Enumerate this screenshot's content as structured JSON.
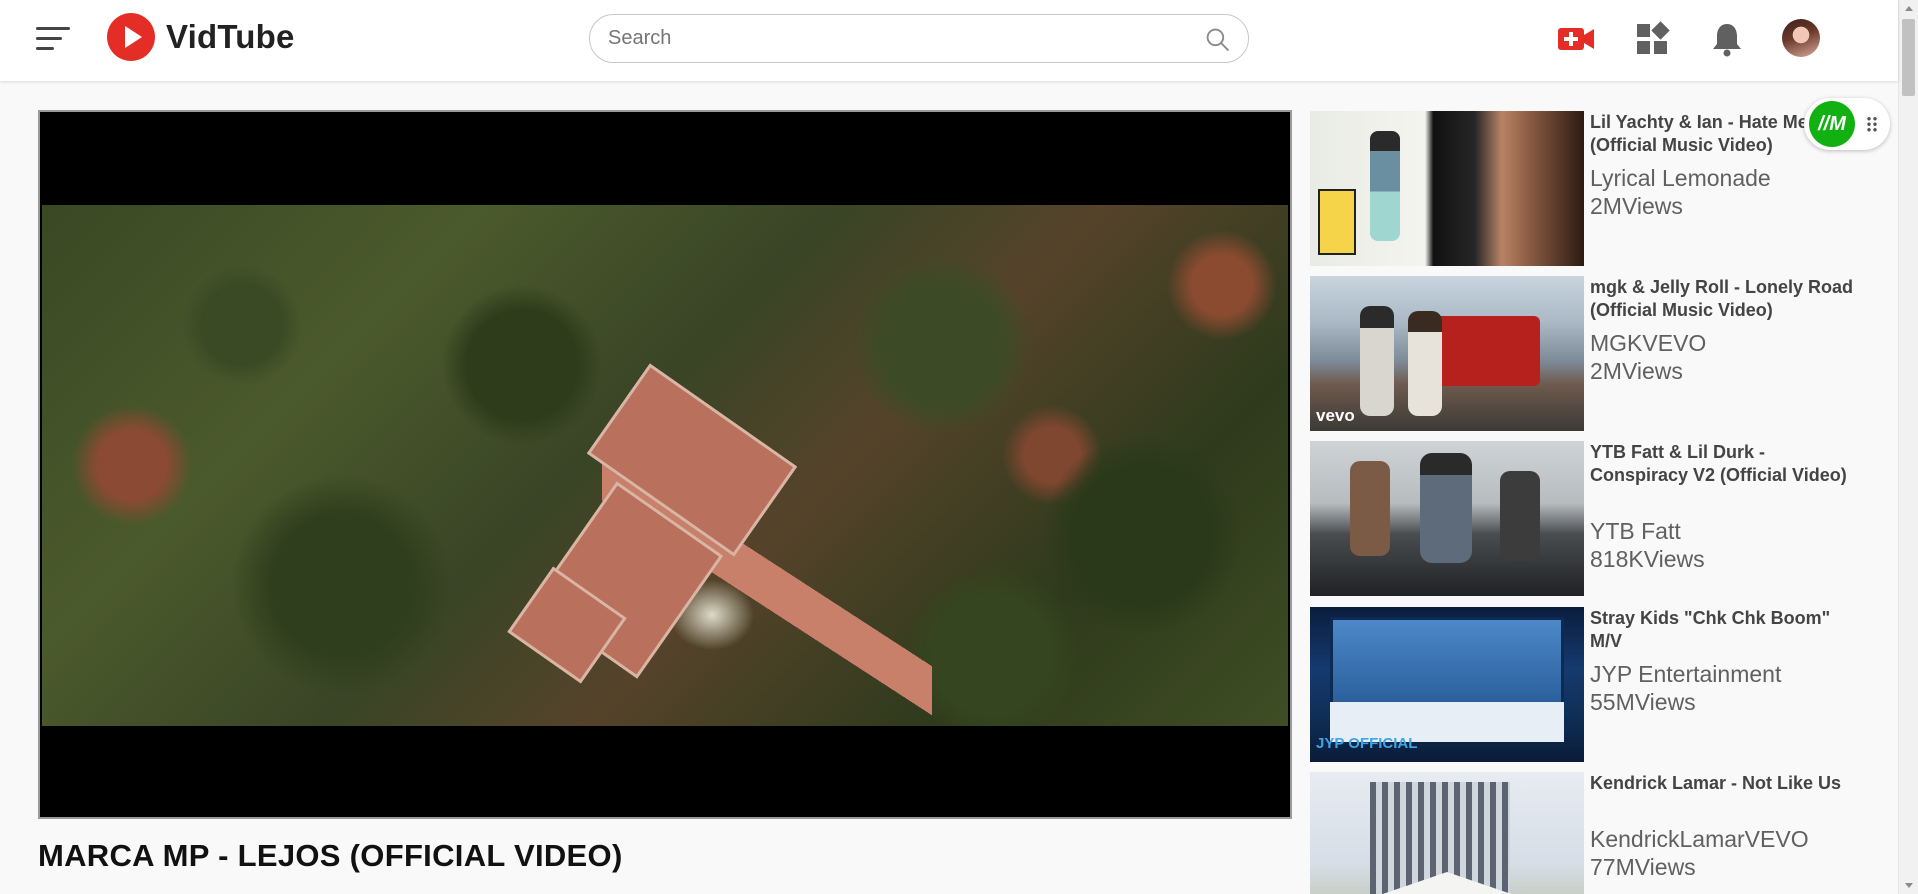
{
  "app": {
    "name": "VidTube"
  },
  "header": {
    "menu_icon": "hamburger-menu-icon",
    "logo_icon": "play-icon",
    "search": {
      "placeholder": "Search",
      "value": "",
      "icon": "search-icon"
    },
    "icons": [
      "video-add-icon",
      "apps-grid-icon",
      "bell-icon"
    ],
    "avatar": "user-avatar"
  },
  "player": {
    "title": "MARCA MP - LEJOS (OFFICIAL VIDEO)"
  },
  "recommendations": [
    {
      "title": "Lil Yachty & Ian - Hate Me (Official Music Video)",
      "channel": "Lyrical Lemonade",
      "views": "2MViews"
    },
    {
      "title": "mgk & Jelly Roll - Lonely Road (Official Music Video)",
      "channel": "MGKVEVO",
      "views": "2MViews"
    },
    {
      "title": "YTB Fatt & Lil Durk - Conspiracy V2 (Official Video)",
      "channel": "YTB Fatt",
      "views": "818KViews"
    },
    {
      "title": "Stray Kids \"Chk Chk Boom\" M/V",
      "channel": "JYP Entertainment",
      "views": "55MViews"
    },
    {
      "title": "Kendrick Lamar - Not Like Us",
      "channel": "KendrickLamarVEVO",
      "views": "77MViews"
    }
  ],
  "thumb_overlays": {
    "vevo": "vevo",
    "jyp": "JYP OFFICIAL"
  },
  "extension": {
    "label": "//M",
    "icon": "drag-handle-icon"
  },
  "colors": {
    "brand_red": "#e52d27",
    "extension_green": "#12b112"
  }
}
